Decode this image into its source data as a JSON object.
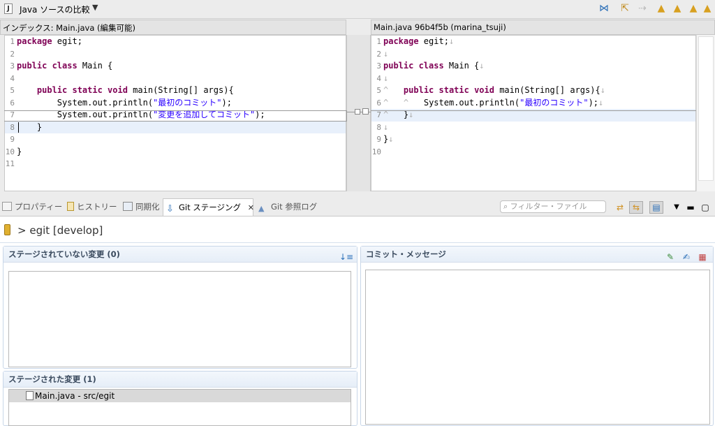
{
  "compare": {
    "title": "Java ソースの比較",
    "dropdown": "▼",
    "left_header": "インデックス: Main.java (編集可能)",
    "right_header": "Main.java 96b4f5b (marina_tsuji)",
    "left_lines": [
      "1",
      "2",
      "3",
      "4",
      "5",
      "6",
      "7",
      "8",
      "9",
      "10",
      "11"
    ],
    "right_lines": [
      "1",
      "2",
      "3",
      "4",
      "5",
      "6",
      "7",
      "8",
      "9",
      "10"
    ]
  },
  "code_left": {
    "l1_kw": "package",
    "l1_rest": " egit;",
    "l3_kw": "public class",
    "l3_rest": " Main {",
    "l5_kw": "public static void",
    "l5_rest": " main(String[] args){",
    "l6_a": "System.out.println(",
    "l6_str": "\"最初のコミット\"",
    "l6_b": ");",
    "l7_a": "System.out.println(",
    "l7_str": "\"変更を追加してコミット\"",
    "l7_b": ");",
    "l8": "}",
    "l10": "}"
  },
  "code_right": {
    "l1_kw": "package",
    "l1_rest": " egit;",
    "l3_kw": "public class",
    "l3_rest": " Main {",
    "l5_kw": "public static void",
    "l5_rest": " main(String[] args){",
    "l6_a": "System.out.println(",
    "l6_str": "\"最初のコミット\"",
    "l6_b": ");",
    "l7": "}",
    "l9": "}",
    "ws_eol": "↓",
    "ws_tab": "^"
  },
  "tabs": {
    "properties": "プロパティー",
    "history": "ヒストリー",
    "sync": "同期化",
    "git_staging": "Git ステージング",
    "git_reflog": "Git 参照ログ",
    "filter_placeholder": "フィルター・ファイル"
  },
  "staging": {
    "repo": "> egit [develop]",
    "unstaged_title": "ステージされていない変更 (0)",
    "staged_title": "ステージされた変更 (1)",
    "staged_file": "Main.java - src/egit",
    "commit_title": "コミット・メッセージ"
  },
  "colors": {
    "keyword": "#7f0055",
    "string": "#2a00ff",
    "highlight": "#e8f0fb",
    "section_header": "#3a4a5e"
  }
}
